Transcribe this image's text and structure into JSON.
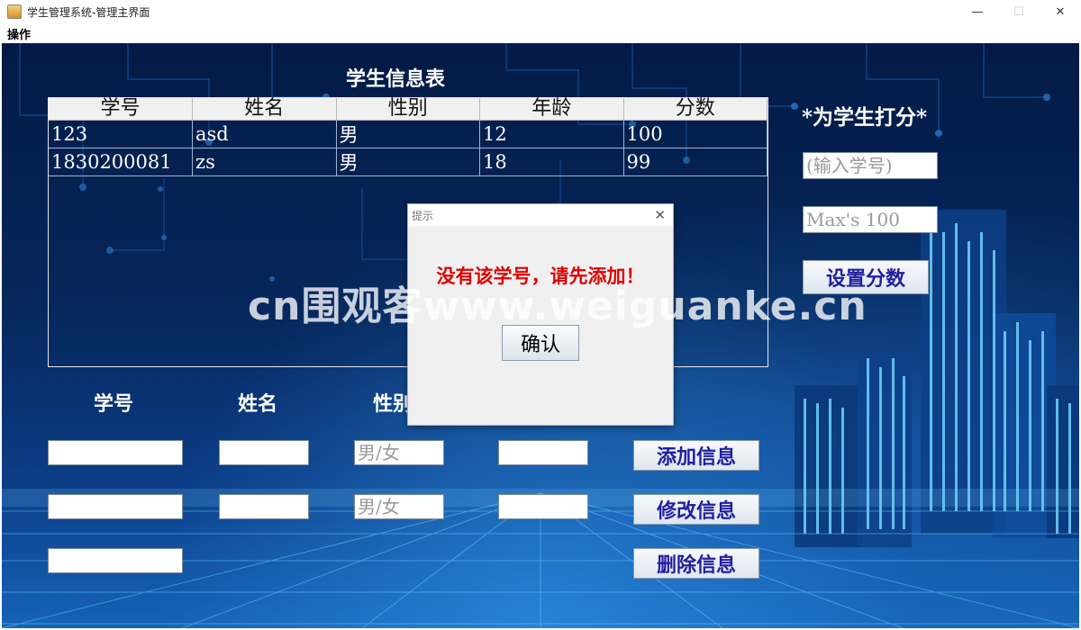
{
  "window": {
    "title": "学生管理系统-管理主界面",
    "minimize": "—",
    "maximize": "☐",
    "close": "✕"
  },
  "menu": {
    "items": [
      "操作"
    ]
  },
  "table": {
    "title": "学生信息表",
    "columns": [
      "学号",
      "姓名",
      "性别",
      "年龄",
      "分数"
    ],
    "rows": [
      [
        "123",
        "asd",
        "男",
        "12",
        "100"
      ],
      [
        "1830200081",
        "zs",
        "男",
        "18",
        "99"
      ]
    ]
  },
  "form": {
    "labels": {
      "id": "学号",
      "name": "姓名",
      "gender": "性别"
    },
    "add_row": {
      "gender_placeholder": "男/女",
      "button": "添加信息"
    },
    "edit_row": {
      "gender_placeholder": "男/女",
      "button": "修改信息"
    },
    "delete_row": {
      "button": "删除信息"
    }
  },
  "score_panel": {
    "title": "*为学生打分*",
    "id_placeholder": "(输入学号)",
    "score_placeholder": "Max's 100",
    "button": "设置分数"
  },
  "dialog": {
    "title": "提示",
    "message": "没有该学号，请先添加！",
    "ok": "确认",
    "close": "✕"
  },
  "watermark": "cn围观客www.weiguanke.cn",
  "colors": {
    "button_text": "#1f1fa0",
    "dialog_message": "#e00000",
    "background": "#06275d"
  }
}
